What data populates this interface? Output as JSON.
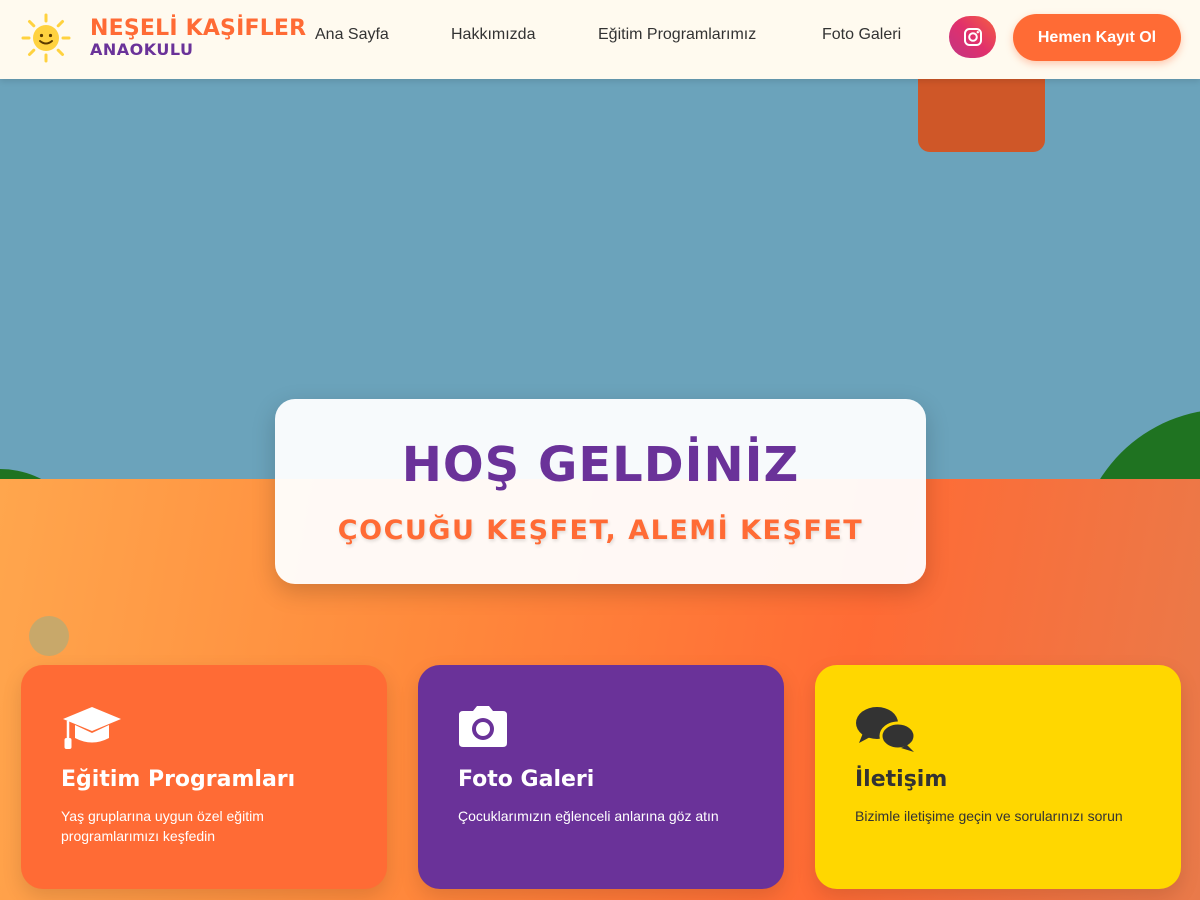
{
  "brand": {
    "title": "NEŞELİ KAŞİFLER",
    "subtitle": "ANAOKULU"
  },
  "nav": {
    "items": [
      "Ana Sayfa",
      "Hakkımızda",
      "Eğitim Programlarımız",
      "Foto Galeri"
    ]
  },
  "header": {
    "cta_label": "Hemen Kayıt Ol",
    "instagram_icon": "instagram-icon"
  },
  "hero": {
    "title": "HOŞ GELDİNİZ",
    "subtitle": "ÇOCUĞU KEŞFET, ALEMİ KEŞFET"
  },
  "cards": [
    {
      "title": "Eğitim Programları",
      "text": "Yaş gruplarına uygun özel eğitim programlarımızı keşfedin",
      "icon": "graduation-cap-icon"
    },
    {
      "title": "Foto Galeri",
      "text": "Çocuklarımızın eğlenceli anlarına göz atın",
      "icon": "camera-icon"
    },
    {
      "title": "İletişim",
      "text": "Bizimle iletişime geçin ve sorularınızı sorun",
      "icon": "chat-bubbles-icon"
    }
  ],
  "colors": {
    "primary": "#ff6b35",
    "purple": "#6a3299",
    "yellow": "#ffd700",
    "sky": "#6ba3bb",
    "grass": "#1f7321"
  }
}
